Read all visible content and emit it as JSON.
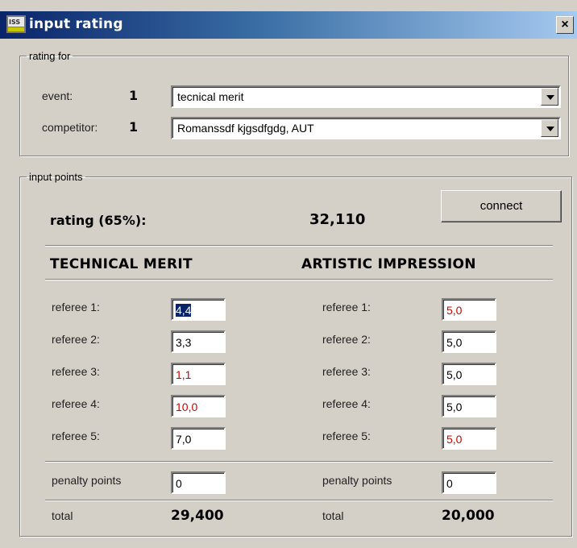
{
  "window": {
    "title": "input rating",
    "close_glyph": "×"
  },
  "rating_for": {
    "legend": "rating for",
    "event": {
      "label": "event:",
      "number": "1",
      "value": "tecnical merit"
    },
    "competitor": {
      "label": "competitor:",
      "number": "1",
      "value": "Romanssdf kjgsdfgdg, AUT"
    }
  },
  "input_points": {
    "legend": "input points",
    "connect_label": "connect",
    "rating_label": "rating (65%):",
    "rating_value": "32,110",
    "technical": {
      "heading": "TECHNICAL MERIT",
      "referees": [
        {
          "label": "referee 1:",
          "value": "4,4",
          "color": "#000000",
          "selected": true
        },
        {
          "label": "referee 2:",
          "value": "3,3",
          "color": "#000000"
        },
        {
          "label": "referee 3:",
          "value": "1,1",
          "color": "#cc0000"
        },
        {
          "label": "referee 4:",
          "value": "10,0",
          "color": "#cc0000"
        },
        {
          "label": "referee 5:",
          "value": "7,0",
          "color": "#000000"
        }
      ],
      "penalty_label": "penalty points",
      "penalty_value": "0",
      "total_label": "total",
      "total_value": "29,400"
    },
    "artistic": {
      "heading": "ARTISTIC IMPRESSION",
      "referees": [
        {
          "label": "referee 1:",
          "value": "5,0",
          "color": "#cc0000"
        },
        {
          "label": "referee 2:",
          "value": "5,0",
          "color": "#000000"
        },
        {
          "label": "referee 3:",
          "value": "5,0",
          "color": "#000000"
        },
        {
          "label": "referee 4:",
          "value": "5,0",
          "color": "#000000"
        },
        {
          "label": "referee 5:",
          "value": "5,0",
          "color": "#cc0000"
        }
      ],
      "penalty_label": "penalty points",
      "penalty_value": "0",
      "total_label": "total",
      "total_value": "20,000"
    }
  }
}
